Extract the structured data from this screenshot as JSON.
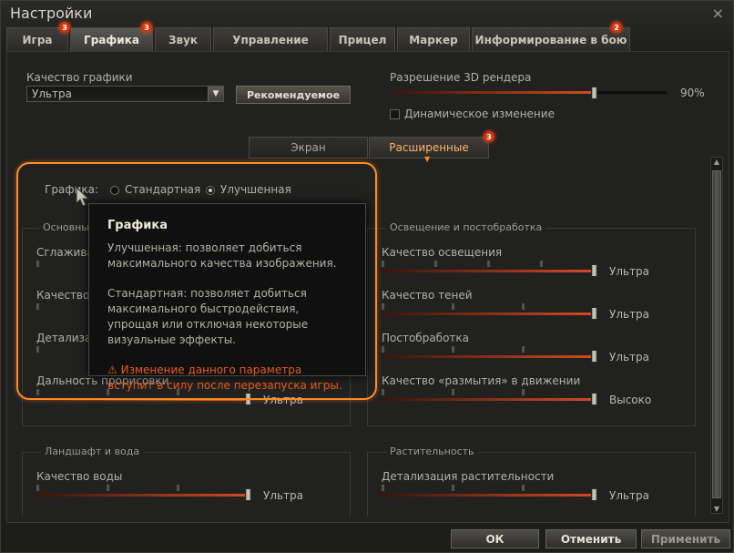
{
  "window": {
    "title": "Настройки",
    "close_icon": "×"
  },
  "tabs": [
    {
      "label": "Игра",
      "badge": "3"
    },
    {
      "label": "Графика",
      "badge": "3"
    },
    {
      "label": "Звук",
      "badge": ""
    },
    {
      "label": "Управление",
      "badge": ""
    },
    {
      "label": "Прицел",
      "badge": ""
    },
    {
      "label": "Маркер",
      "badge": ""
    },
    {
      "label": "Информирование в бою",
      "badge": "2"
    }
  ],
  "graphics_quality": {
    "label": "Качество графики",
    "value": "Ультра",
    "recommended_button": "Рекомендуемое"
  },
  "render_resolution": {
    "label": "Разрешение 3D рендера",
    "value": "90%",
    "dynamic_label": "Динамическое изменение"
  },
  "subtabs": [
    {
      "label": "Экран"
    },
    {
      "label": "Расширенные",
      "badge": "3"
    }
  ],
  "graphics_mode": {
    "label": "Графика:",
    "options": [
      "Стандартная",
      "Улучшенная"
    ],
    "selected": "Улучшенная"
  },
  "groups": {
    "basic": {
      "title": "Основные",
      "rows": [
        {
          "label": "Сглаживание",
          "value": ""
        },
        {
          "label": "Качество текстур",
          "value": ""
        },
        {
          "label": "Детализация объектов",
          "value": ""
        },
        {
          "label": "Дальность прорисовки",
          "value": "Ультра"
        }
      ]
    },
    "lighting": {
      "title": "Освещение и постобработка",
      "rows": [
        {
          "label": "Качество освещения",
          "value": "Ультра"
        },
        {
          "label": "Качество теней",
          "value": "Ультра"
        },
        {
          "label": "Постобработка",
          "value": "Ультра"
        },
        {
          "label": "Качество «размытия» в движении",
          "value": "Высоко"
        }
      ]
    },
    "terrain": {
      "title": "Ландшафт и вода",
      "rows": [
        {
          "label": "Качество воды",
          "value": "Ультра"
        }
      ]
    },
    "vegetation": {
      "title": "Растительность",
      "rows": [
        {
          "label": "Детализация растительности",
          "value": "Ультра"
        }
      ]
    }
  },
  "tooltip": {
    "title": "Графика",
    "text1": "Улучшенная: позволяет добиться максимального качества изображения.",
    "text2": "Стандартная: позволяет добиться максимального быстродействия, упрощая или отключая некоторые визуальные эффекты.",
    "warning_icon": "⚠",
    "warning": "Изменение данного параметра вступит в силу после перезапуска игры."
  },
  "footer": {
    "ok": "ОК",
    "cancel": "Отменить",
    "apply": "Применить"
  },
  "colors": {
    "accent": "#ff8c22",
    "badge": "#e03c12",
    "warning": "#e85a1a",
    "slider": "#c2461f"
  }
}
